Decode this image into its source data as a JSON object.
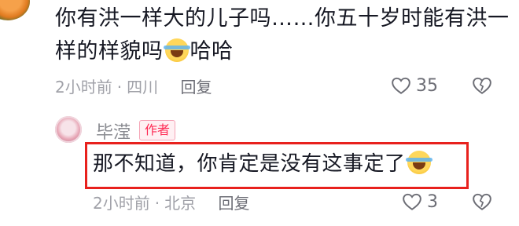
{
  "comment": {
    "text_line1": "你有洪一样大的儿子吗……你五十岁时能有洪一",
    "text_line2": "样的样貌吗",
    "emoji": "laughing-crying-emoji",
    "text_after_emoji": "哈哈",
    "time": "2小时前",
    "location": "四川",
    "reply_label": "回复",
    "like_count": "35"
  },
  "reply": {
    "username": "毕滢",
    "author_badge": "作者",
    "text": "那不知道，你肯定是没有这事定了",
    "emoji": "laughing-crying-emoji",
    "time": "2小时前",
    "location": "北京",
    "reply_label": "回复",
    "like_count": "3"
  },
  "colors": {
    "highlight_border": "#e8211d",
    "author_badge": "#fe2c55",
    "meta_text": "#a0a1a8"
  }
}
